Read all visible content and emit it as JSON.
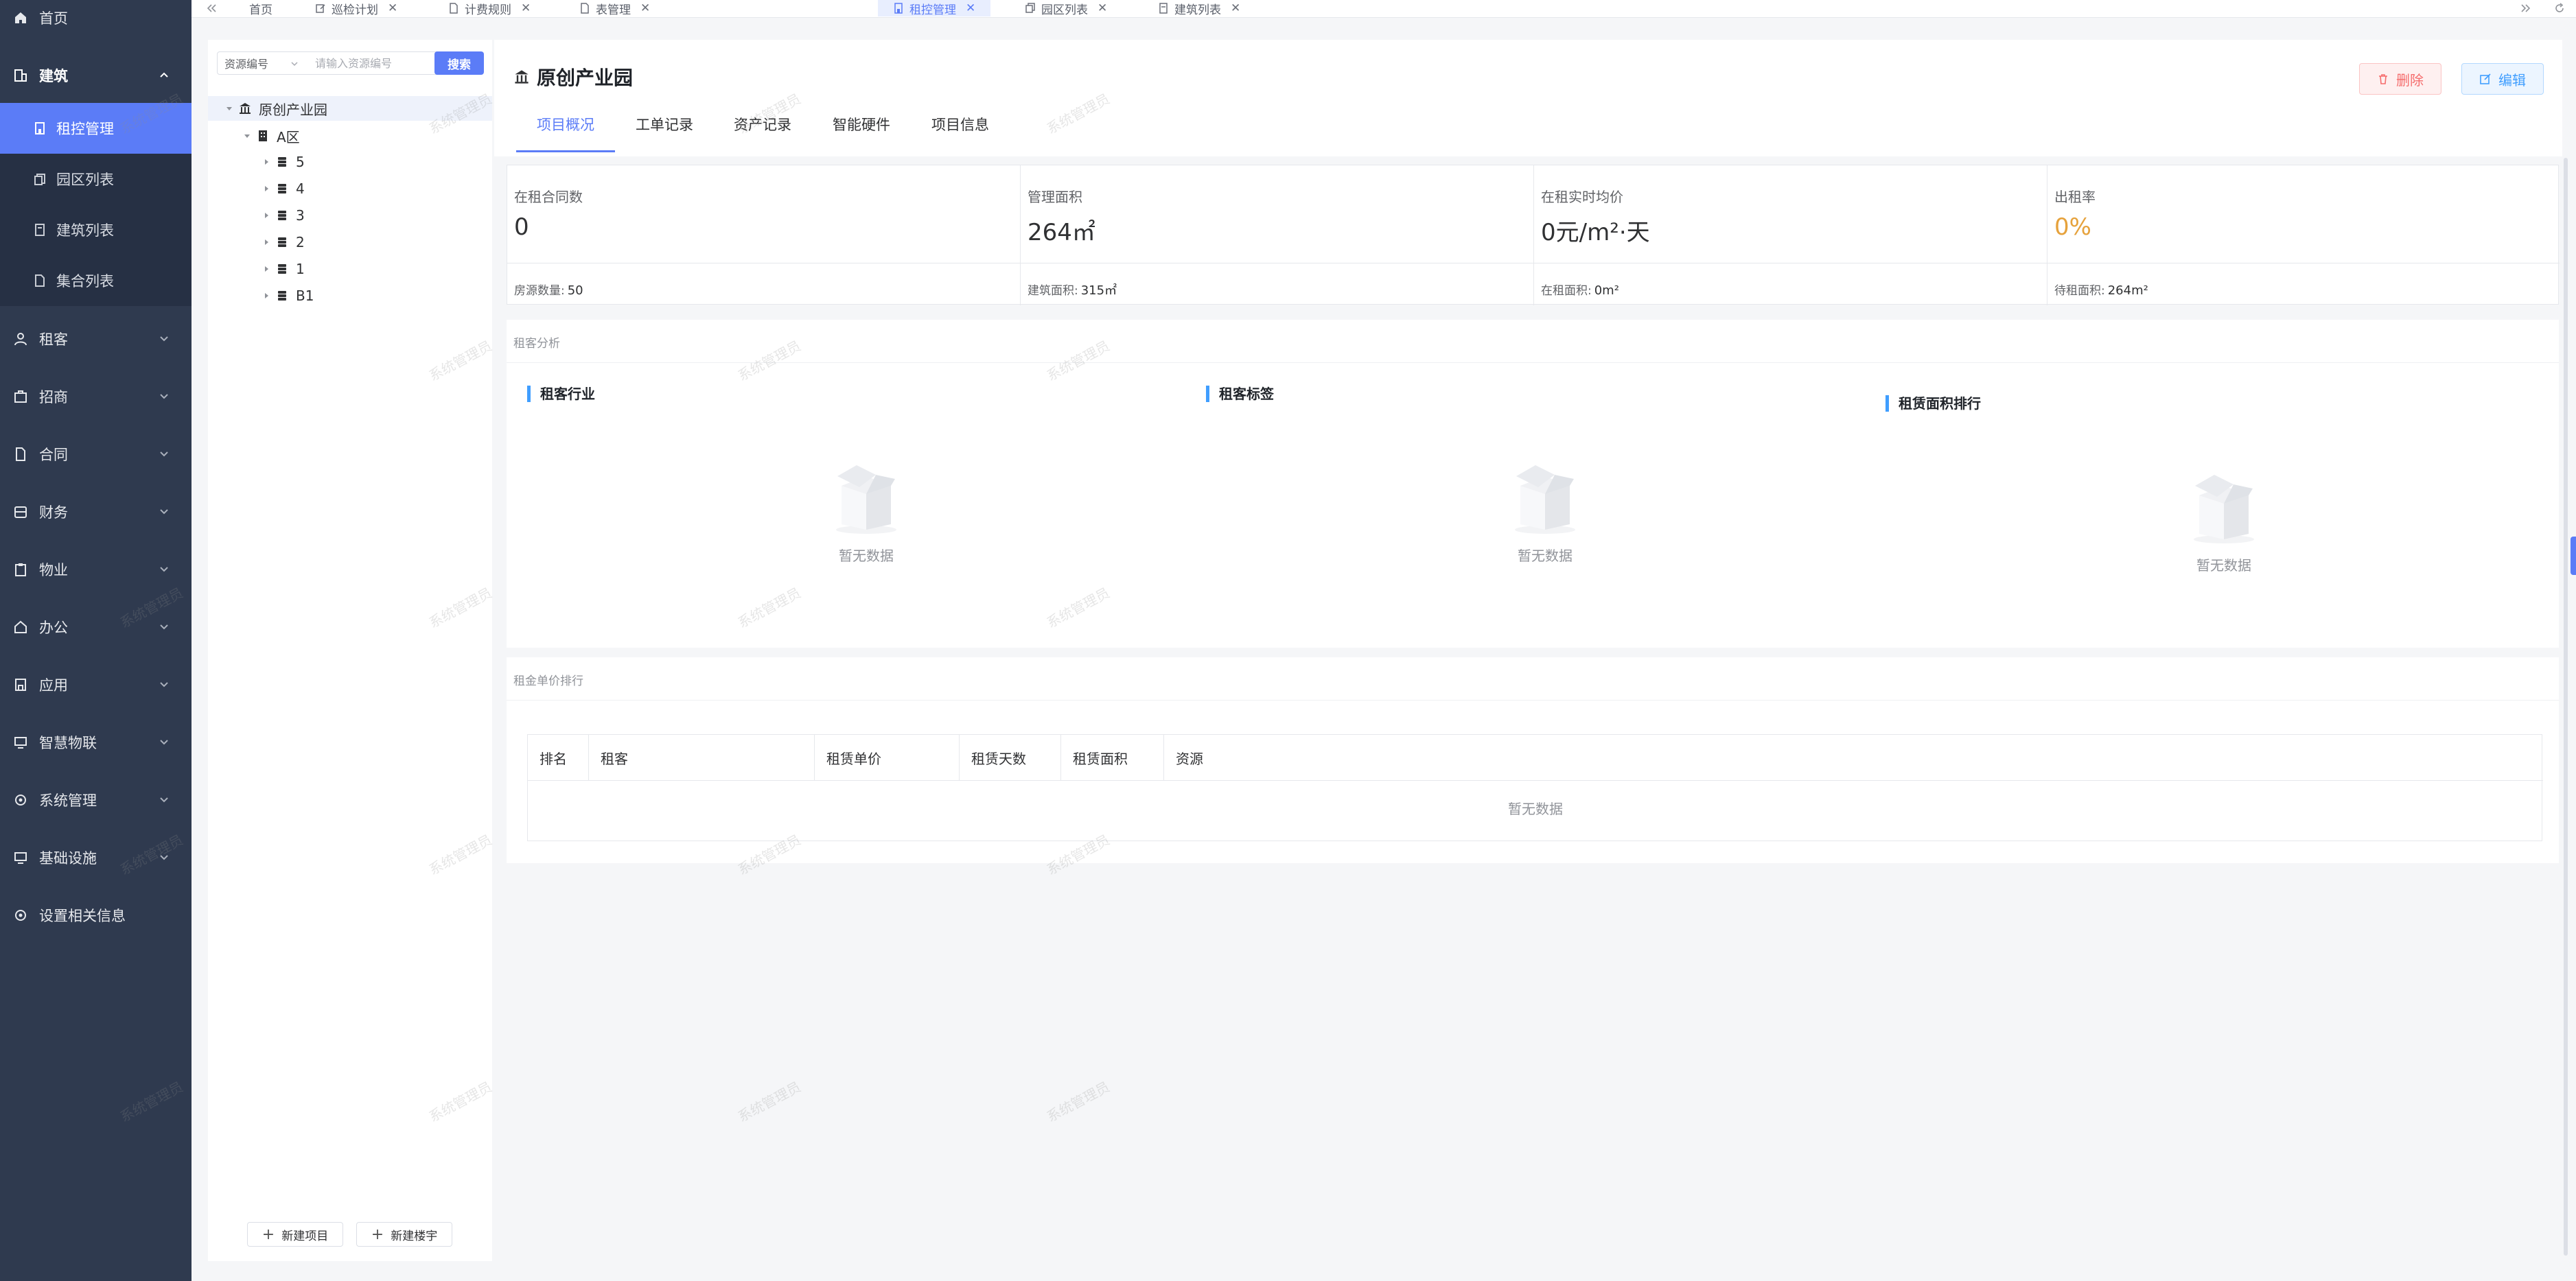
{
  "sidebar": {
    "items": [
      {
        "label": "首页",
        "icon": "home-icon"
      },
      {
        "label": "建筑",
        "icon": "building-icon"
      },
      {
        "label": "租客",
        "icon": "user-icon"
      },
      {
        "label": "招商",
        "icon": "briefcase-icon"
      },
      {
        "label": "合同",
        "icon": "document-icon"
      },
      {
        "label": "财务",
        "icon": "database-icon"
      },
      {
        "label": "物业",
        "icon": "clipboard-icon"
      },
      {
        "label": "办公",
        "icon": "house-icon"
      },
      {
        "label": "应用",
        "icon": "app-icon"
      },
      {
        "label": "智慧物联",
        "icon": "monitor-icon"
      },
      {
        "label": "系统管理",
        "icon": "gear-icon"
      },
      {
        "label": "基础设施",
        "icon": "monitor-icon"
      },
      {
        "label": "设置相关信息",
        "icon": "gear-icon"
      }
    ],
    "sub_items": [
      {
        "label": "租控管理",
        "icon": "building-small-icon"
      },
      {
        "label": "园区列表",
        "icon": "copy-icon"
      },
      {
        "label": "建筑列表",
        "icon": "document-icon"
      },
      {
        "label": "集合列表",
        "icon": "file-icon"
      }
    ]
  },
  "tabs": [
    {
      "label": "首页"
    },
    {
      "label": "巡检计划"
    },
    {
      "label": "计费规则"
    },
    {
      "label": "表管理"
    },
    {
      "label": "租控管理"
    },
    {
      "label": "园区列表"
    },
    {
      "label": "建筑列表"
    }
  ],
  "tree": {
    "select_label": "资源编号",
    "search_placeholder": "请输入资源编号",
    "search_button": "搜索",
    "root": "原创产业园",
    "zone": "A区",
    "buildings": [
      "5",
      "4",
      "3",
      "2",
      "1",
      "B1"
    ],
    "new_project": "新建项目",
    "new_building": "新建楼宇"
  },
  "header": {
    "title": "原创产业园",
    "delete_label": "删除",
    "edit_label": "编辑",
    "tabs": [
      "项目概况",
      "工单记录",
      "资产记录",
      "智能硬件",
      "项目信息"
    ]
  },
  "stats": [
    {
      "label": "在租合同数",
      "value": "0",
      "sub_label": "房源数量:",
      "sub_value": "50"
    },
    {
      "label": "管理面积",
      "value": "264㎡",
      "sub_label": "建筑面积:",
      "sub_value": "315㎡"
    },
    {
      "label": "在租实时均价",
      "value": "0元/m²·天",
      "sub_label": "在租面积:",
      "sub_value": "0m²"
    },
    {
      "label": "出租率",
      "value": "0%",
      "sub_label": "待租面积:",
      "sub_value": "264m²"
    }
  ],
  "analysis": {
    "title": "租客分析",
    "sections": [
      "租客行业",
      "租客标签",
      "租赁面积排行"
    ],
    "empty_text": "暂无数据"
  },
  "ranking": {
    "title": "租金单价排行",
    "columns": [
      "排名",
      "租客",
      "租赁单价",
      "租赁天数",
      "租赁面积",
      "资源"
    ],
    "empty_text": "暂无数据"
  },
  "watermark": "系统管理员",
  "colors": {
    "sidebar": "#2f3a4f",
    "accent": "#5b7cf7",
    "yellow": "#e6a23c",
    "danger": "#f56c6c"
  }
}
